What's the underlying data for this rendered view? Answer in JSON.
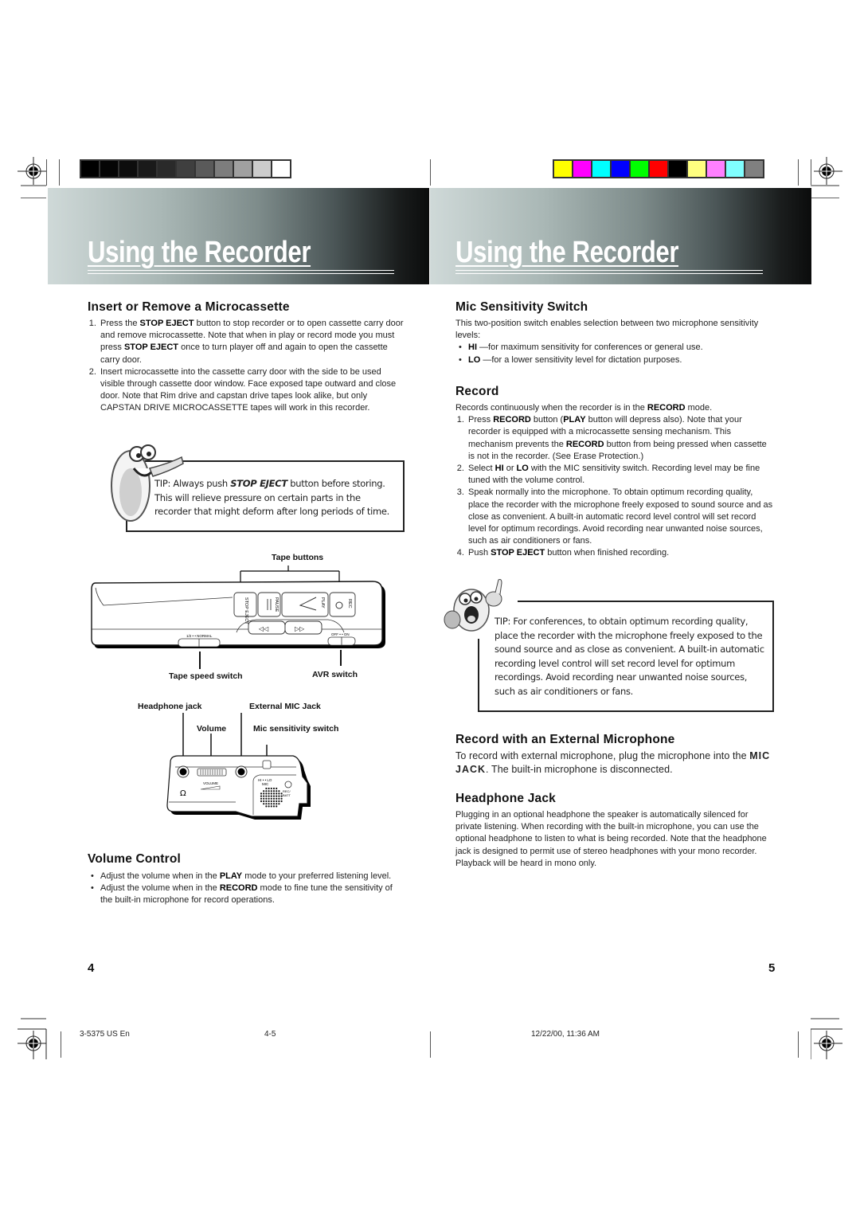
{
  "header": {
    "left_title": "Using the Recorder",
    "right_title": "Using the Recorder"
  },
  "color_bars": {
    "grayscale": [
      "#000000",
      "#050505",
      "#0d0d0d",
      "#1a1a1a",
      "#2a2a2a",
      "#3f3f3f",
      "#5a5a5a",
      "#7d7d7d",
      "#a0a0a0",
      "#cccccc",
      "#ffffff"
    ],
    "color": [
      "#ffff00",
      "#ff00ff",
      "#00ffff",
      "#0000ff",
      "#00ff00",
      "#ff0000",
      "#000000",
      "#ffff80",
      "#ff80ff",
      "#80ffff",
      "#808080"
    ]
  },
  "left": {
    "insert": {
      "heading": "Insert or Remove a Microcassette",
      "items": [
        {
          "parts": [
            "Press the ",
            "STOP EJECT",
            " button to stop recorder or to open cassette carry door and remove microcassette. Note that when in play or record mode you must press ",
            "STOP EJECT",
            " once to turn player off and again to open the cassette carry door."
          ]
        },
        {
          "text": "Insert  microcassette into the cassette carry door with the side to be used visible through cassette door window. Face exposed tape outward and close door. Note that  Rim drive and capstan drive  tapes look alike, but only CAPSTAN DRIVE MICROCASSETTE tapes will work in this recorder."
        }
      ]
    },
    "tip": {
      "pre": "TIP: Always push ",
      "bold": "STOP EJECT",
      "post": " button before storing. This will relieve pressure on certain parts in the recorder that might deform after long periods of time."
    },
    "diagram_top": {
      "tape_buttons": "Tape buttons",
      "tape_speed_switch": "Tape speed switch",
      "avr_switch": "AVR switch",
      "btn_stop": "STOP EJECT",
      "btn_pause": "PAUSE",
      "btn_play": "PLAY",
      "btn_rec": "REC",
      "speed_marking": "1/2 • • NORMAL",
      "avr_marking": "OFF • • ON"
    },
    "diagram_bottom": {
      "headphone_jack": "Headphone jack",
      "external_mic_jack": "External MIC Jack",
      "volume": "Volume",
      "mic_sensitivity_switch": "Mic sensitivity switch",
      "volume_marking": "VOLUME",
      "hilo_marking": "HI • • LO",
      "mic_marking": "MIC",
      "rec_batt_marking": "REC/ BATT"
    },
    "volume": {
      "heading": "Volume Control",
      "bullets": [
        {
          "pre": "Adjust the volume when in the ",
          "bold": "PLAY",
          "post": " mode to your preferred listening level."
        },
        {
          "pre": "Adjust the volume when in the ",
          "bold": "RECORD",
          "post": " mode to fine tune the sensitivity of the built-in microphone for record operations."
        }
      ]
    },
    "page_number": "4"
  },
  "right": {
    "mic": {
      "heading": "Mic Sensitivity Switch",
      "intro": "This two-position switch enables selection between two microphone sensitivity levels:",
      "bullets": [
        {
          "bold": "HI",
          "post": " —for maximum sensitivity for conferences or general use."
        },
        {
          "bold": "LO",
          "post": " —for a lower sensitivity level for dictation purposes."
        }
      ]
    },
    "record": {
      "heading": "Record",
      "intro_pre": "Records continuously when the recorder is in the ",
      "intro_bold": "RECORD",
      "intro_post": " mode.",
      "items": [
        {
          "parts": [
            "Press ",
            "RECORD",
            " button (",
            "PLAY",
            " button will depress also). Note that your recorder is equipped with a microcassette sensing mechanism. This mechanism prevents the ",
            "RECORD",
            " button from being pressed when cassette is not in the recorder. (See Erase  Protection.)"
          ]
        },
        {
          "parts": [
            "Select ",
            "HI",
            " or ",
            "LO",
            " with the MIC sensitivity switch. Recording level may be fine tuned with the volume control."
          ]
        },
        {
          "parts": [
            "Speak normally into the microphone. To obtain optimum recording quality, place the recorder with the microphone freely exposed to sound source and as close as convenient. A built-in automatic record level control will set record level for optimum recordings. Avoid recording near unwanted noise sources, such as air conditioners or fans."
          ]
        },
        {
          "parts": [
            "Push ",
            "STOP EJECT",
            " button when finished recording."
          ]
        }
      ]
    },
    "tip": {
      "text": "TIP: For conferences, to obtain optimum recording quality, place the recorder with the microphone freely exposed to the sound source and as close as convenient. A built-in automatic recording level control will set record level for optimum recordings. Avoid recording near unwanted noise sources, such as air conditioners or fans."
    },
    "external": {
      "heading": "Record with an External Microphone",
      "pre": "To record with external microphone,  plug the microphone into the ",
      "bold": "MIC JACK",
      "post": ". The built-in microphone is disconnected."
    },
    "headphone": {
      "heading": "Headphone Jack",
      "text": "Plugging in an optional headphone  the speaker is automatically silenced for private listening. When recording with the built-in microphone, you can use the optional headphone to listen to what is being recorded. Note that the headphone jack is designed to permit use of stereo headphones with your mono recorder. Playback will be heard in mono only."
    },
    "page_number": "5"
  },
  "footer": {
    "doc_code": "3-5375 US En",
    "pages": "4-5",
    "timestamp": "12/22/00, 11:36 AM"
  }
}
